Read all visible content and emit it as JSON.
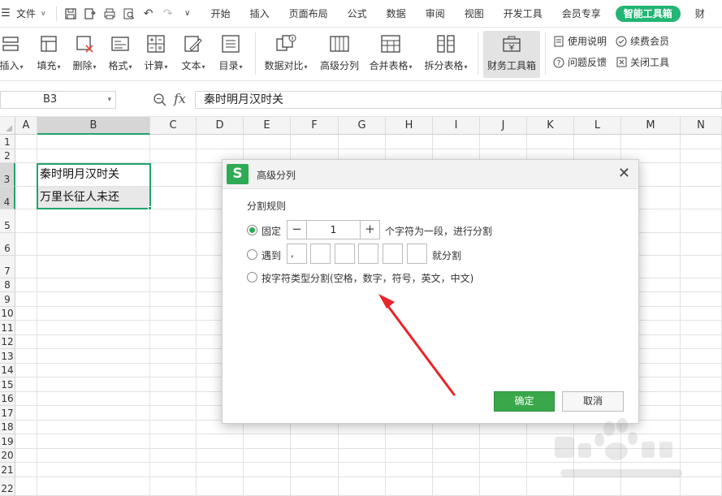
{
  "menubar": {
    "file_label": "文件",
    "tabs": [
      "开始",
      "插入",
      "页面布局",
      "公式",
      "数据",
      "审阅",
      "视图",
      "开发工具",
      "会员专享",
      "智能工具箱",
      "财"
    ],
    "active_tab_index": 9
  },
  "ribbon": {
    "left_group": [
      {
        "label": "插入",
        "icon": "insert-icon"
      },
      {
        "label": "填充",
        "icon": "fill-icon"
      },
      {
        "label": "删除",
        "icon": "delete-icon"
      },
      {
        "label": "格式",
        "icon": "format-icon"
      },
      {
        "label": "计算",
        "icon": "calculate-icon"
      },
      {
        "label": "文本",
        "icon": "text-icon"
      },
      {
        "label": "目录",
        "icon": "catalog-icon"
      }
    ],
    "mid_group": [
      {
        "label": "数据对比",
        "icon": "data-compare-icon"
      },
      {
        "label": "高级分列",
        "icon": "advanced-split-icon"
      },
      {
        "label": "合并表格",
        "icon": "merge-table-icon"
      },
      {
        "label": "拆分表格",
        "icon": "split-table-icon"
      }
    ],
    "finance_label": "财务工具箱",
    "small": {
      "help": "使用说明",
      "renew": "续费会员",
      "feedback": "问题反馈",
      "close_tools": "关闭工具"
    }
  },
  "formula_bar": {
    "cell_ref": "B3",
    "fx_label": "fx",
    "content": "秦时明月汉时关"
  },
  "sheet": {
    "columns": [
      "A",
      "B",
      "C",
      "D",
      "E",
      "F",
      "G",
      "H",
      "I",
      "J",
      "K",
      "L",
      "M",
      "N"
    ],
    "rows": [
      "1",
      "2",
      "3",
      "4",
      "5",
      "6",
      "7",
      "8",
      "9",
      "10",
      "11",
      "12",
      "13",
      "14",
      "15",
      "16",
      "17",
      "18",
      "19",
      "20",
      "21",
      "22"
    ],
    "b3": "秦时明月汉时关",
    "b4": "万里长征人未还"
  },
  "dialog": {
    "title": "高级分列",
    "section": "分割规则",
    "opt_fixed": "固定",
    "stepper_minus": "−",
    "stepper_value": "1",
    "stepper_plus": "+",
    "fixed_suffix": "个字符为一段，进行分割",
    "opt_encounter": "遇到",
    "delimiter_first": ",",
    "encounter_suffix": "就分割",
    "opt_by_type": "按字符类型分割(空格，数字，符号，英文，中文)",
    "ok": "确定",
    "cancel": "取消"
  },
  "colors": {
    "accent_green": "#22a36b",
    "ok_button": "#3aa84a",
    "arrow_red": "#e8252a"
  }
}
